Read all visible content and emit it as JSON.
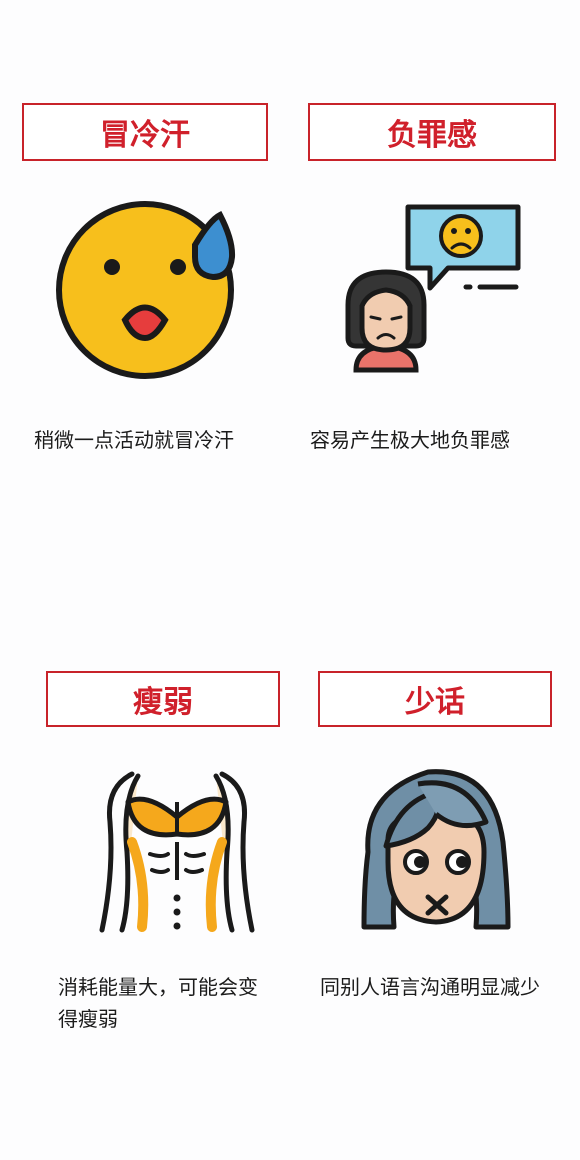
{
  "cards": [
    {
      "title": "冒冷汗",
      "icon": "sweating-face-icon",
      "description": "稍微一点活动就冒冷汗"
    },
    {
      "title": "负罪感",
      "icon": "guilty-woman-with-sad-speech-bubble-icon",
      "description": "容易产生极大地负罪感"
    },
    {
      "title": "瘦弱",
      "icon": "thin-torso-ribs-icon",
      "description": "消耗能量大，可能会变得瘦弱"
    },
    {
      "title": "少话",
      "icon": "woman-mouth-sealed-icon",
      "description": "同别人语言沟通明显减少"
    }
  ],
  "colors": {
    "title_border": "#c8232a",
    "title_text": "#d0202b",
    "face_yellow": "#f7bf1c",
    "sweat_blue": "#3d8fd0",
    "skin": "#f1ccb0",
    "hair_blue_gray": "#6f8fa6",
    "bubble_blue": "#8fd3ea"
  }
}
